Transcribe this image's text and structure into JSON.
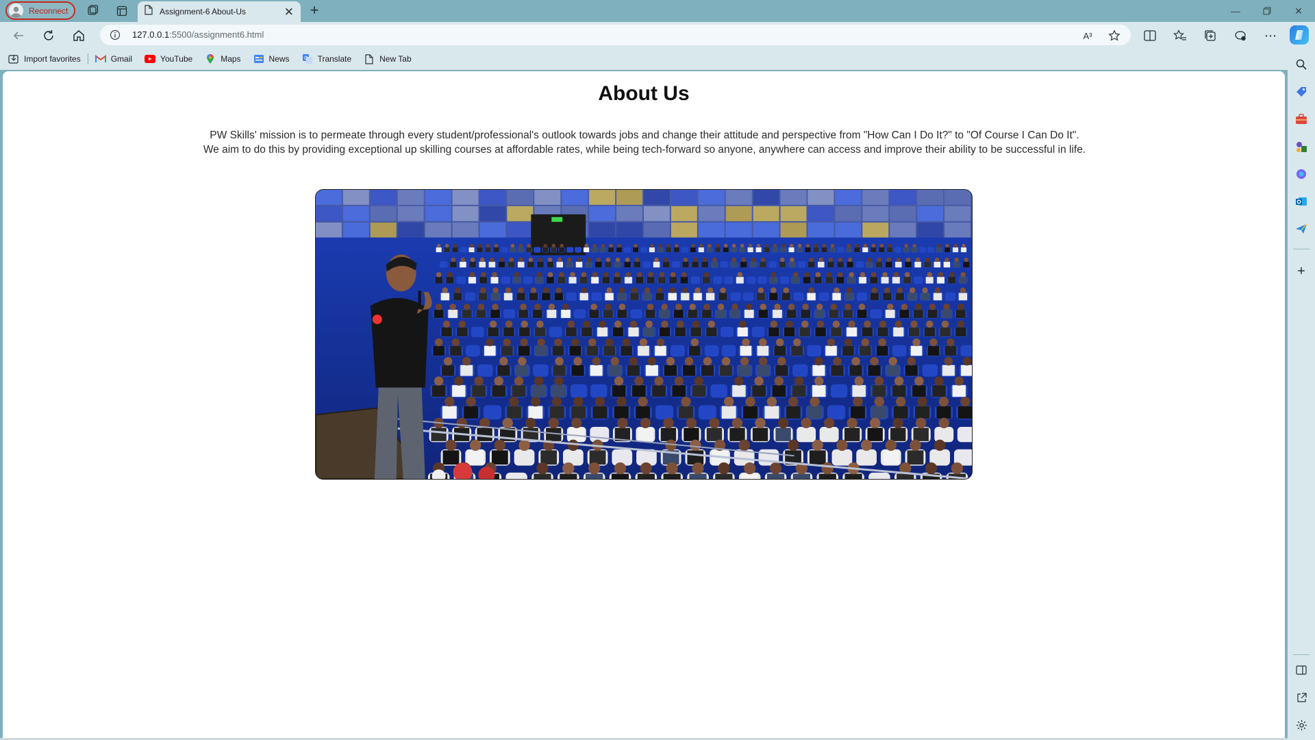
{
  "browser": {
    "profile_label": "Reconnect",
    "tab_title": "Assignment-6 About-Us",
    "url_host": "127.0.0.1",
    "url_path": ":5500/assignment6.html",
    "read_aloud_label": "A³"
  },
  "favorites": [
    {
      "label": "Import favorites",
      "icon": "import-icon"
    },
    {
      "label": "Gmail",
      "icon": "gmail-icon"
    },
    {
      "label": "YouTube",
      "icon": "youtube-icon"
    },
    {
      "label": "Maps",
      "icon": "maps-icon"
    },
    {
      "label": "News",
      "icon": "news-icon"
    },
    {
      "label": "Translate",
      "icon": "translate-icon"
    },
    {
      "label": "New Tab",
      "icon": "page-icon"
    }
  ],
  "page": {
    "title": "About Us",
    "mission_line1": "PW Skills' mission is to permeate through every student/professional's outlook towards jobs and change their attitude and perspective from \"How Can I Do It?\" to \"Of Course I Can Do It\".",
    "mission_line2": "We aim to do this by providing exceptional up skilling courses at affordable rates, while being tech-forward so anyone, anywhere can access and improve their ability to be successful in life."
  },
  "colors": {
    "frame": "#7fb0bd",
    "toolbar": "#d9e8ec",
    "reconnect_red": "#c42b1c",
    "seat_blue": "#1f3fa8"
  }
}
